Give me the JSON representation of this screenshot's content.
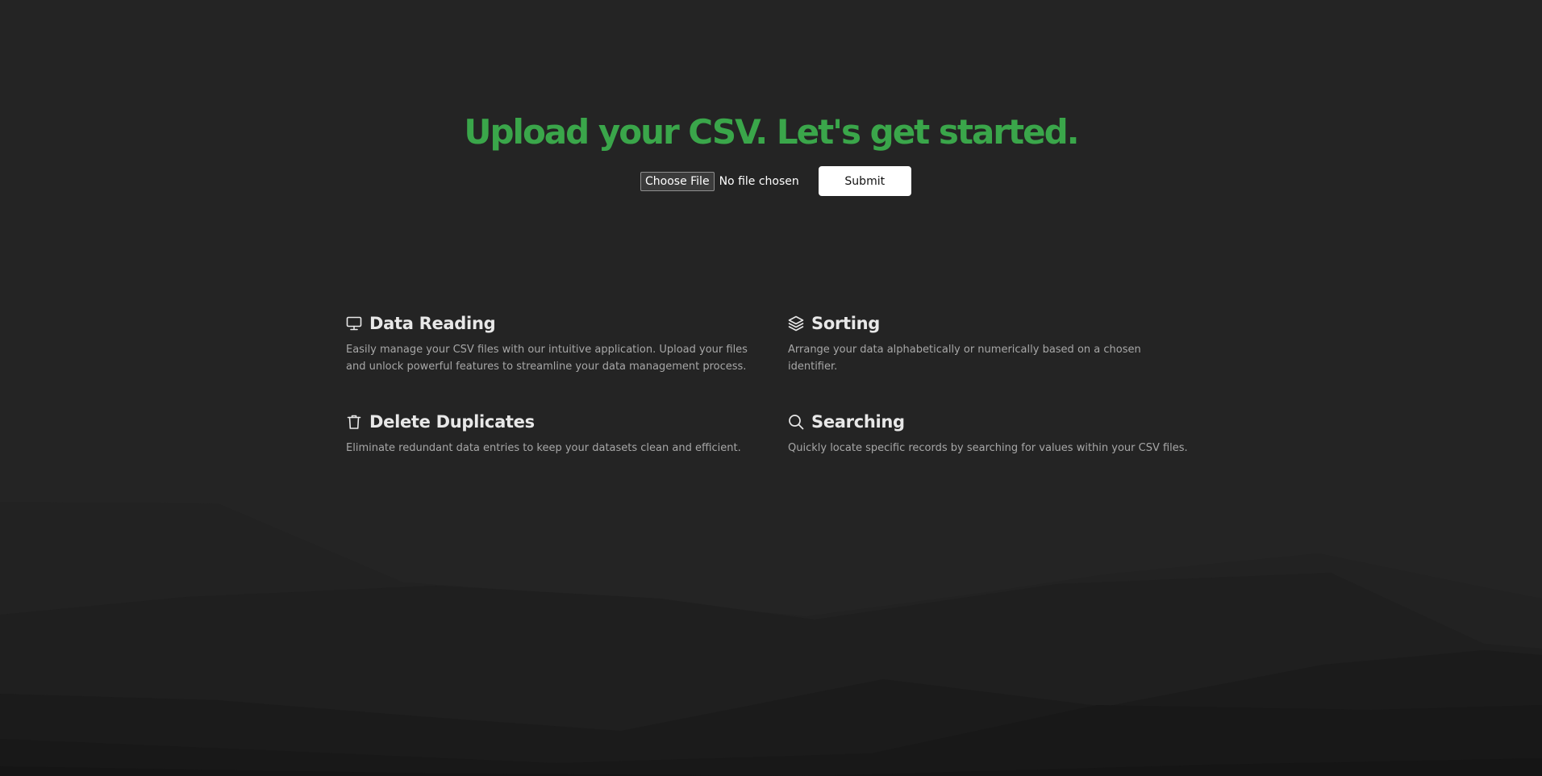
{
  "hero": {
    "title": "Upload your CSV. Let's get started."
  },
  "upload": {
    "choose_file_label": "Choose File",
    "file_status": "No file chosen",
    "submit_label": "Submit"
  },
  "features": [
    {
      "icon": "monitor-icon",
      "title": "Data Reading",
      "description": "Easily manage your CSV files with our intuitive application. Upload your files and unlock powerful features to streamline your data management process."
    },
    {
      "icon": "layers-icon",
      "title": "Sorting",
      "description": "Arrange your data alphabetically or numerically based on a chosen identifier."
    },
    {
      "icon": "trash-icon",
      "title": "Delete Duplicates",
      "description": "Eliminate redundant data entries to keep your datasets clean and efficient."
    },
    {
      "icon": "search-icon",
      "title": "Searching",
      "description": "Quickly locate specific records by searching for values within your CSV files."
    }
  ],
  "colors": {
    "background": "#242424",
    "accent_green": "#3aa64a",
    "heading_text": "#e8e8e8",
    "body_text": "#a7a7a7",
    "button_bg": "#ffffff"
  }
}
